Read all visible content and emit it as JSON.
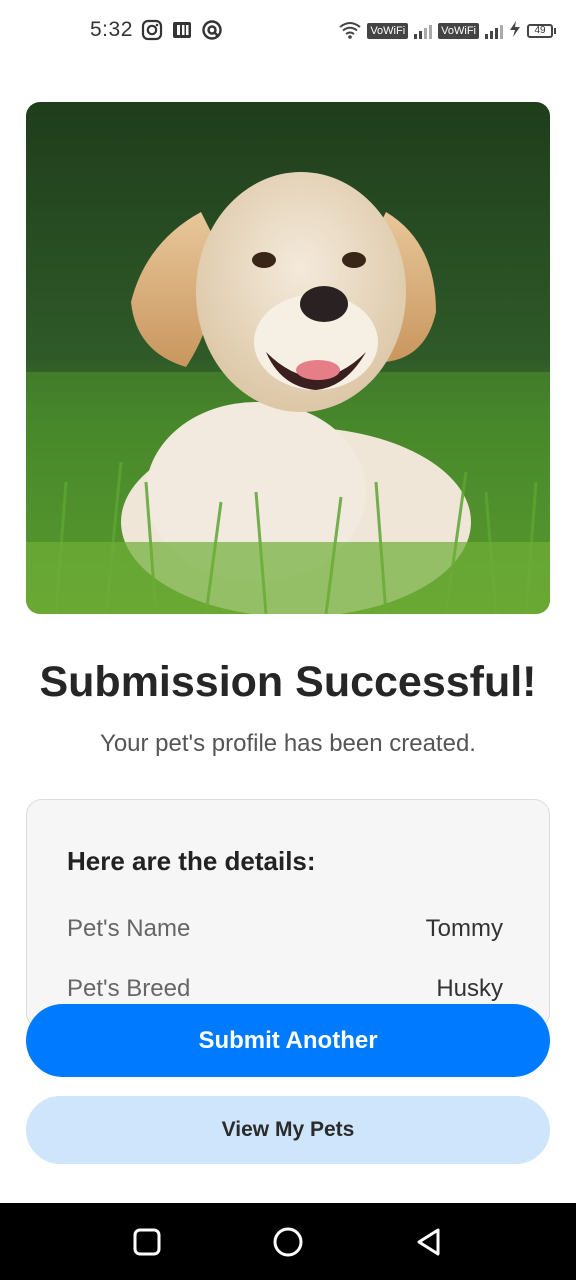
{
  "status_bar": {
    "time": "5:32",
    "vowifi_1": "VoWiFi",
    "vowifi_2": "VoWiFi",
    "battery": "49"
  },
  "hero": {
    "icon": "puppy-photo"
  },
  "header": {
    "title": "Submission Successful!",
    "subtitle": "Your pet's profile has been created."
  },
  "details": {
    "heading": "Here are the details:",
    "rows": [
      {
        "label": "Pet's Name",
        "value": "Tommy"
      },
      {
        "label": "Pet's Breed",
        "value": "Husky"
      }
    ]
  },
  "actions": {
    "primary_label": "Submit Another",
    "secondary_label": "View My Pets"
  },
  "colors": {
    "primary": "#007bff",
    "secondary_bg": "#cfe5fb"
  }
}
